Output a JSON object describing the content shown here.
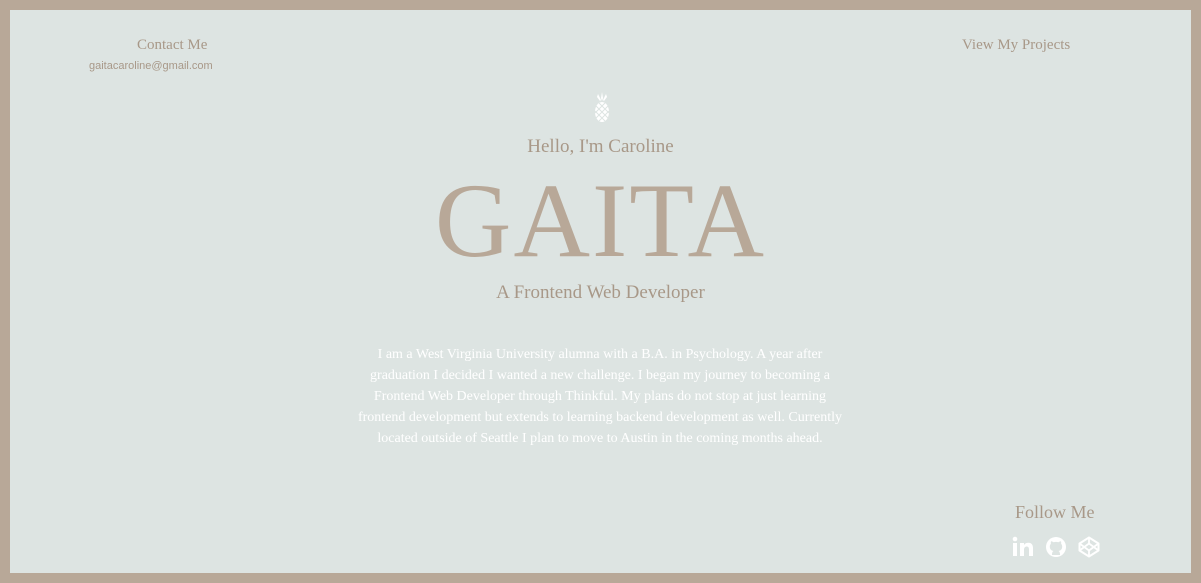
{
  "header": {
    "contact_label": "Contact Me",
    "email": "gaitacaroline@gmail.com",
    "projects_label": "View My Projects"
  },
  "hero": {
    "logo_icon": "pineapple-icon",
    "greeting": "Hello, I'm Caroline",
    "name": "GAITA",
    "role": "A Frontend Web Developer",
    "bio": "I am a West Virginia University alumna with a B.A. in Psychology. A year after graduation I decided I wanted a new challenge. I began my journey to becoming a Frontend Web Developer through Thinkful. My plans do not stop at just learning frontend development but extends to learning backend development as well. Currently located outside of Seattle I plan to move to Austin in the coming months ahead."
  },
  "footer": {
    "follow_label": "Follow Me",
    "social": [
      {
        "icon": "linkedin-icon"
      },
      {
        "icon": "github-icon"
      },
      {
        "icon": "codepen-icon"
      }
    ]
  },
  "colors": {
    "border": "#b8a898",
    "background": "#dde4e2",
    "accent": "#a89888",
    "bio_text": "#ffffff"
  }
}
